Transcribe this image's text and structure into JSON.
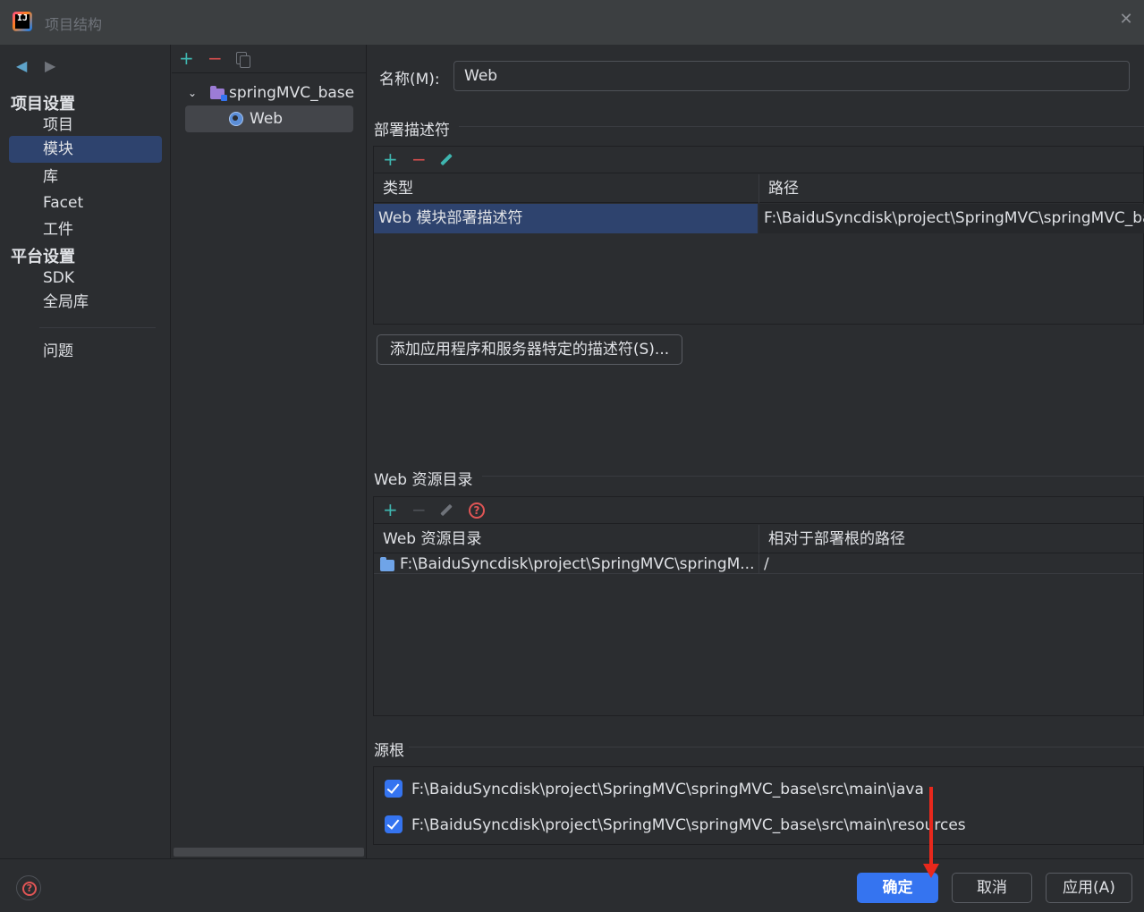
{
  "window": {
    "title": "项目结构",
    "close_icon": "close-icon"
  },
  "nav": {
    "project_settings_heading": "项目设置",
    "platform_settings_heading": "平台设置",
    "items": [
      {
        "label": "项目"
      },
      {
        "label": "模块",
        "selected": true
      },
      {
        "label": "库"
      },
      {
        "label": "Facet"
      },
      {
        "label": "工件"
      },
      {
        "label": "SDK"
      },
      {
        "label": "全局库"
      },
      {
        "label": "问题"
      }
    ]
  },
  "tree": {
    "items": [
      {
        "label": "springMVC_base",
        "icon": "module-folder-icon",
        "expanded": true
      },
      {
        "label": "Web",
        "icon": "web-globe-icon",
        "selected": true
      }
    ]
  },
  "main": {
    "name_label": "名称(M):",
    "name_value": "Web",
    "deployment": {
      "title": "部署描述符",
      "columns": [
        "类型",
        "路径"
      ],
      "rows": [
        {
          "type": "Web 模块部署描述符",
          "path": "F:\\BaiduSyncdisk\\project\\SpringMVC\\springMVC_base"
        }
      ],
      "add_button": "添加应用程序和服务器特定的描述符(S)..."
    },
    "web_resources": {
      "title": "Web 资源目录",
      "columns": [
        "Web 资源目录",
        "相对于部署根的路径"
      ],
      "rows": [
        {
          "dir": "F:\\BaiduSyncdisk\\project\\SpringMVC\\springM...",
          "relative": "/"
        }
      ]
    },
    "source_roots": {
      "title": "源根",
      "items": [
        {
          "path": "F:\\BaiduSyncdisk\\project\\SpringMVC\\springMVC_base\\src\\main\\java",
          "checked": true
        },
        {
          "path": "F:\\BaiduSyncdisk\\project\\SpringMVC\\springMVC_base\\src\\main\\resources",
          "checked": true
        }
      ]
    }
  },
  "footer": {
    "ok": "确定",
    "cancel": "取消",
    "apply": "应用(A)"
  },
  "colors": {
    "accent": "#3574f0",
    "selection": "#2e436e",
    "add": "#3fb6b0",
    "remove": "#d24d4d",
    "annotation_arrow": "#e8281c"
  }
}
